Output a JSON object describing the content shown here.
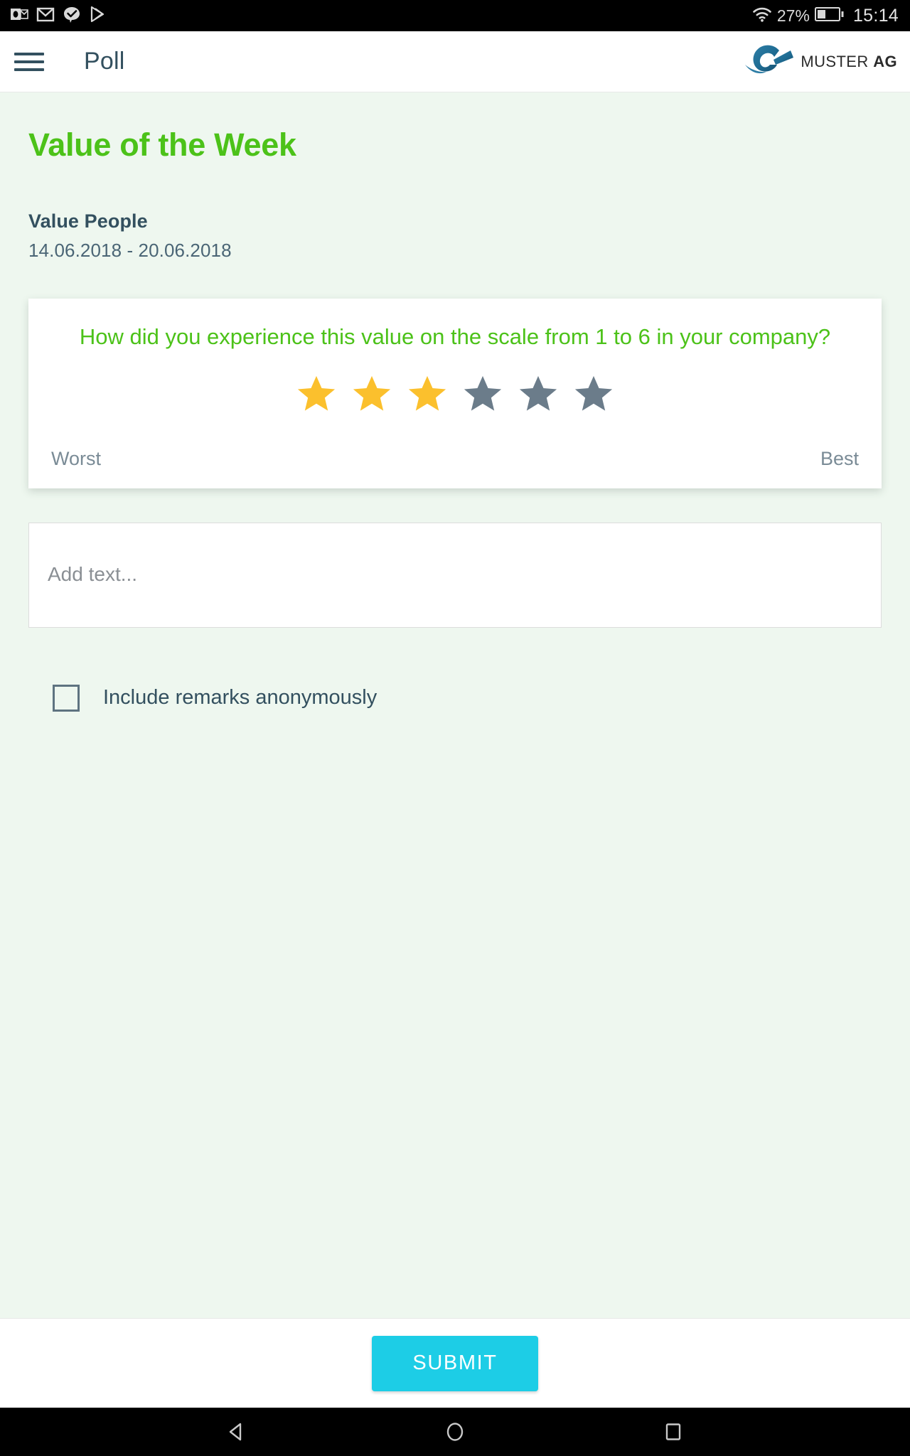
{
  "status_bar": {
    "icons": [
      "outlook-icon",
      "gmail-icon",
      "message-check-icon",
      "play-store-icon"
    ],
    "wifi_icon": "wifi-icon",
    "battery_percent": "27%",
    "battery_icon": "battery-icon",
    "time": "15:14"
  },
  "app_bar": {
    "menu_icon": "hamburger-menu-icon",
    "title": "Poll",
    "brand_logo_icon": "muster-ag-logo-icon",
    "brand_name": "MUSTER",
    "brand_suffix": "AG"
  },
  "page": {
    "title": "Value of the Week",
    "value_name": "Value People",
    "date_range": "14.06.2018 - 20.06.2018"
  },
  "rating_card": {
    "question": "How did you experience this value on the scale from 1 to 6 in your company?",
    "total_stars": 6,
    "selected_stars": 3,
    "filled_color": "#FBC02D",
    "empty_color": "#6B7C8A",
    "worst_label": "Worst",
    "best_label": "Best"
  },
  "remarks": {
    "placeholder": "Add text...",
    "value": "",
    "anonymous_label": "Include remarks anonymously",
    "anonymous_checked": false
  },
  "footer": {
    "submit_label": "SUBMIT",
    "submit_color": "#1DCDE6"
  },
  "nav_bar": {
    "back_icon": "back-triangle-icon",
    "home_icon": "home-circle-icon",
    "recents_icon": "recents-square-icon"
  },
  "colors": {
    "background": "#EEF7EF",
    "accent_green": "#4CC219",
    "text_slate": "#33505F"
  }
}
